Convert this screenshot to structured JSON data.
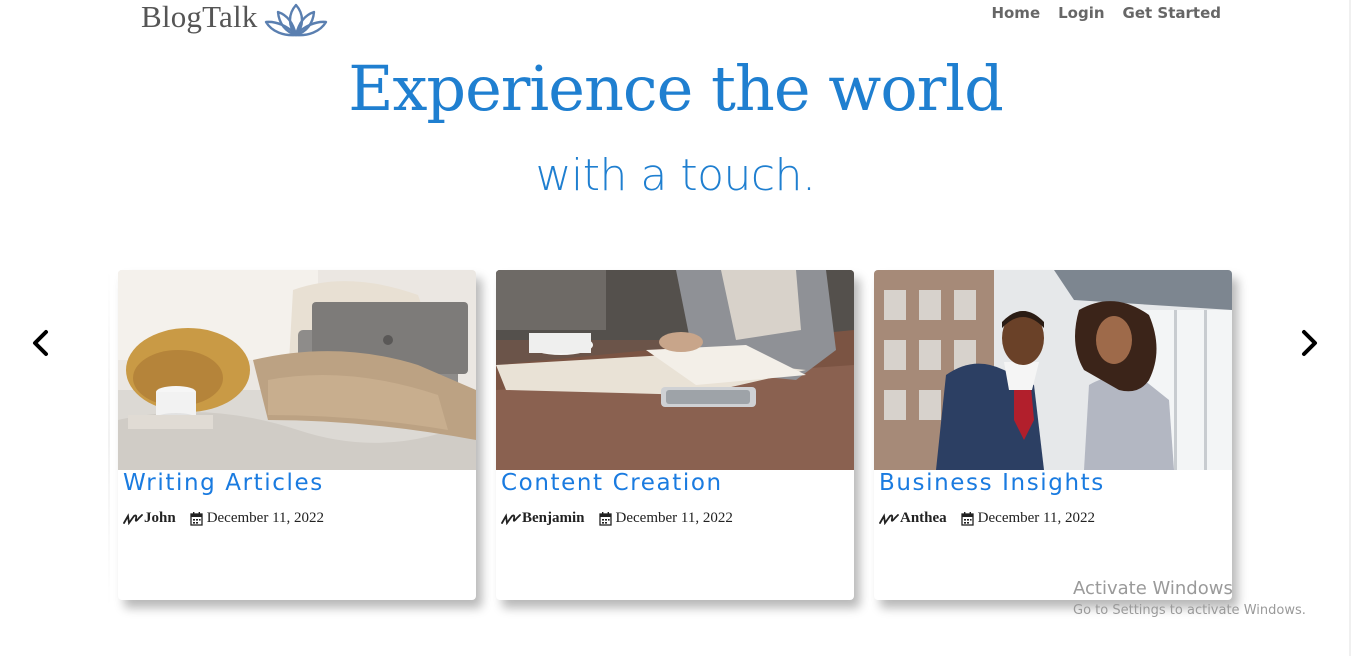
{
  "header": {
    "brand": "BlogTalk",
    "nav": [
      "Home",
      "Login",
      "Get Started"
    ]
  },
  "hero": {
    "title": "Experience the world",
    "subtitle": "with a touch."
  },
  "cards": [
    {
      "title": "Writing Articles",
      "author": "John",
      "date": "December 11, 2022",
      "image": "woman-laptop-bed"
    },
    {
      "title": "Content Creation",
      "author": "Benjamin",
      "date": "December 11, 2022",
      "image": "hand-writing-notebook"
    },
    {
      "title": "Business Insights",
      "author": "Anthea",
      "date": "December 11, 2022",
      "image": "business-people"
    }
  ],
  "watermark": {
    "title": "Activate Windows",
    "subtitle": "Go to Settings to activate Windows."
  },
  "colors": {
    "accent": "#1f7fd0",
    "card_title": "#1a7be0",
    "nav": "#666666"
  }
}
